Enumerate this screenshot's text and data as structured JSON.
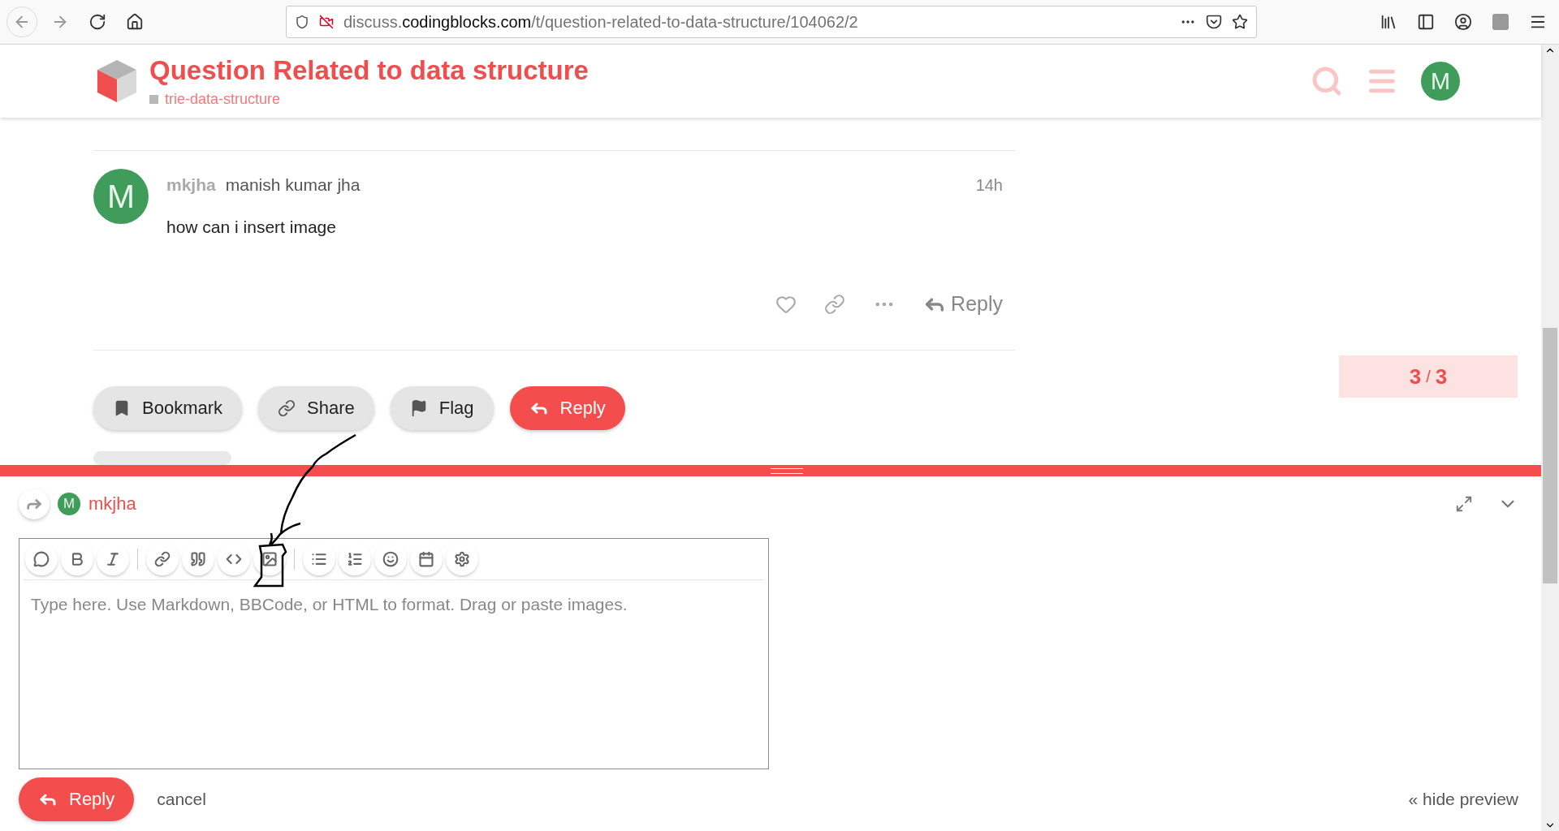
{
  "browser": {
    "url_host_prefix": "discuss.",
    "url_domain": "codingblocks.com",
    "url_path": "/t/question-related-to-data-structure/104062/2"
  },
  "header": {
    "title": "Question Related to data structure",
    "category": "trie-data-structure",
    "avatar_letter": "M"
  },
  "post": {
    "avatar_letter": "M",
    "username": "mkjha",
    "full_name": "manish kumar jha",
    "time": "14h",
    "body": "how can i insert image",
    "reply_label": "Reply"
  },
  "topic_buttons": [
    {
      "kind": "bookmark",
      "label": "Bookmark"
    },
    {
      "kind": "share",
      "label": "Share"
    },
    {
      "kind": "flag",
      "label": "Flag"
    },
    {
      "kind": "reply",
      "label": "Reply"
    }
  ],
  "timeline": {
    "current": "3",
    "separator": "/",
    "total": "3"
  },
  "composer": {
    "avatar_letter": "M",
    "reply_to": "mkjha",
    "placeholder": "Type here. Use Markdown, BBCode, or HTML to format. Drag or paste images.",
    "submit_label": "Reply",
    "cancel_label": "cancel",
    "preview_toggle": "« hide preview"
  }
}
